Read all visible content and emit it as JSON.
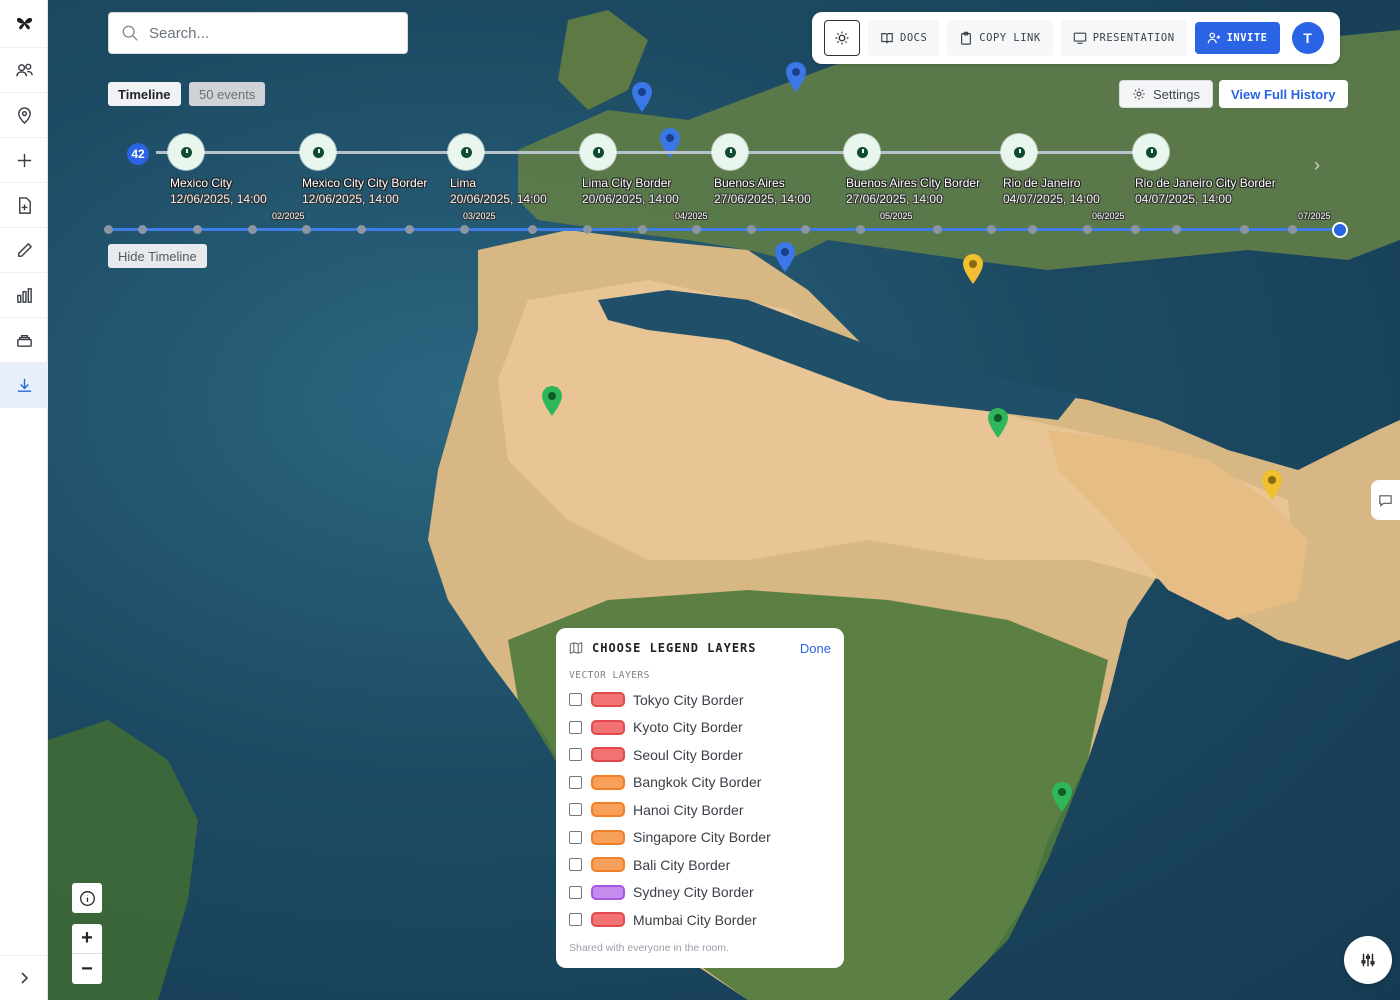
{
  "sidebar": {
    "items": [
      {
        "name": "logo-icon",
        "icon": "butterfly"
      },
      {
        "name": "users-icon",
        "icon": "users"
      },
      {
        "name": "location-icon",
        "icon": "map-pin"
      },
      {
        "name": "add-icon",
        "icon": "plus"
      },
      {
        "name": "add-document-icon",
        "icon": "file-plus"
      },
      {
        "name": "pencil-icon",
        "icon": "pencil"
      },
      {
        "name": "chart-icon",
        "icon": "bar-chart"
      },
      {
        "name": "layers-icon",
        "icon": "stack"
      },
      {
        "name": "download-icon",
        "icon": "download"
      }
    ],
    "expand_icon": "chevron-right"
  },
  "search": {
    "placeholder": "Search..."
  },
  "toolbar": {
    "theme_icon": "sun",
    "docs_label": "DOCS",
    "copy_link_label": "COPY LINK",
    "presentation_label": "PRESENTATION",
    "invite_label": "INVITE",
    "avatar_initial": "T",
    "accent_color": "#2a63e4"
  },
  "timeline": {
    "tab_label": "Timeline",
    "event_count_label": "50 events",
    "settings_label": "Settings",
    "history_label": "View Full History",
    "hide_label": "Hide Timeline",
    "cluster_count": "42",
    "events": [
      {
        "title": "Mexico City",
        "date": "12/06/2025, 14:00"
      },
      {
        "title": "Mexico City City Border",
        "date": "12/06/2025, 14:00"
      },
      {
        "title": "Lima",
        "date": "20/06/2025, 14:00"
      },
      {
        "title": "Lima City Border",
        "date": "20/06/2025, 14:00"
      },
      {
        "title": "Buenos Aires",
        "date": "27/06/2025, 14:00"
      },
      {
        "title": "Buenos Aires City Border",
        "date": "27/06/2025, 14:00"
      },
      {
        "title": "Rio de Janeiro",
        "date": "04/07/2025, 14:00"
      },
      {
        "title": "Rio de Janeiro City Border",
        "date": "04/07/2025, 14:00"
      }
    ],
    "months": [
      "02/2025",
      "03/2025",
      "04/2025",
      "05/2025",
      "06/2025",
      "07/2025"
    ]
  },
  "legend": {
    "title": "CHOOSE LEGEND LAYERS",
    "done_label": "Done",
    "section_label": "VECTOR LAYERS",
    "layers": [
      {
        "label": "Tokyo City Border",
        "fill": "#f27272",
        "stroke": "#e04a4a",
        "checked": false
      },
      {
        "label": "Kyoto City Border",
        "fill": "#f27272",
        "stroke": "#e04a4a",
        "checked": false
      },
      {
        "label": "Seoul City Border",
        "fill": "#f27272",
        "stroke": "#e04a4a",
        "checked": false
      },
      {
        "label": "Bangkok City Border",
        "fill": "#f7a05a",
        "stroke": "#ee7f2b",
        "checked": false
      },
      {
        "label": "Hanoi City Border",
        "fill": "#f7a05a",
        "stroke": "#ee7f2b",
        "checked": false
      },
      {
        "label": "Singapore City Border",
        "fill": "#f7a05a",
        "stroke": "#ee7f2b",
        "checked": false
      },
      {
        "label": "Bali City Border",
        "fill": "#f7a05a",
        "stroke": "#ee7f2b",
        "checked": false
      },
      {
        "label": "Sydney City Border",
        "fill": "#c58cf0",
        "stroke": "#a35ae0",
        "checked": false
      },
      {
        "label": "Mumbai City Border",
        "fill": "#f27272",
        "stroke": "#e04a4a",
        "checked": false
      }
    ],
    "footer": "Shared with everyone in the room."
  },
  "map": {
    "pin_colors": {
      "blue": "#3b78e7",
      "green": "#2fb55a",
      "yellow": "#f0c030"
    },
    "controls": {
      "info_icon": "info",
      "zoom_in": "+",
      "zoom_out": "−",
      "comment_icon": "comment",
      "filter_icon": "sliders"
    }
  }
}
